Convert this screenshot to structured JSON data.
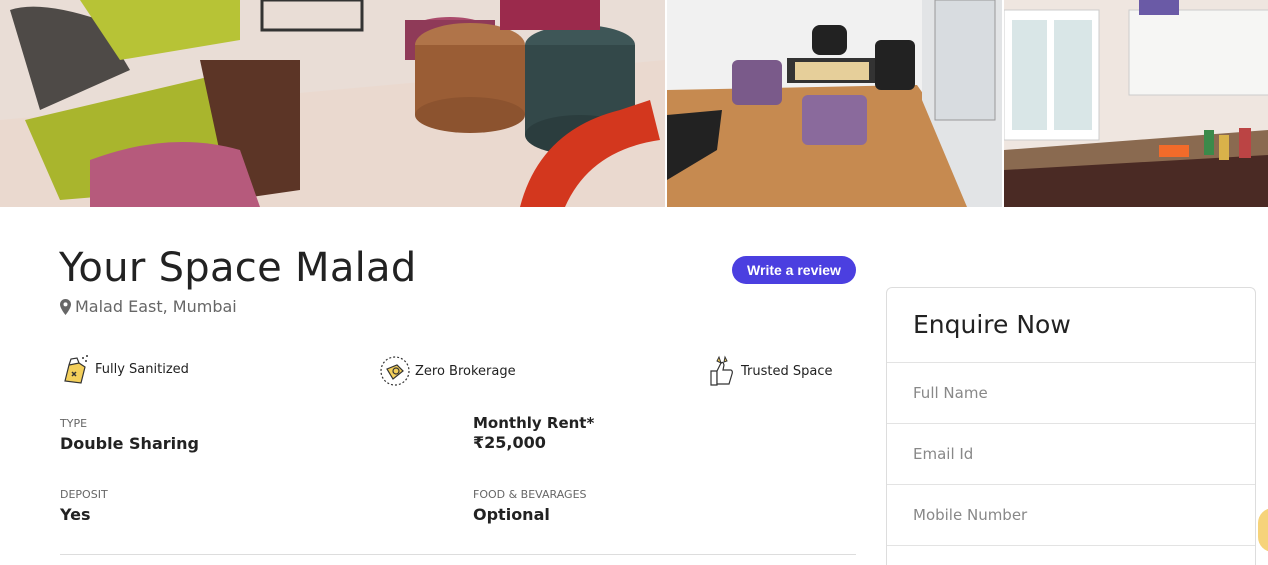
{
  "gallery": {
    "images": [
      {
        "icon": "lounge-photo"
      },
      {
        "icon": "game-room-photo"
      },
      {
        "icon": "kitchen-photo"
      }
    ]
  },
  "listing": {
    "title": "Your Space Malad",
    "location": "Malad East, Mumbai",
    "review_button": "Write a review"
  },
  "features": [
    {
      "label": "Fully Sanitized",
      "icon": "sanitizer-icon"
    },
    {
      "label": "Zero Brokerage",
      "icon": "zero-brokerage-icon"
    },
    {
      "label": "Trusted Space",
      "icon": "thumbs-up-icon"
    }
  ],
  "details": {
    "type_label": "TYPE",
    "type_value": "Double Sharing",
    "rent_label": "Monthly Rent*",
    "rent_value": "₹25,000",
    "deposit_label": "DEPOSIT",
    "deposit_value": "Yes",
    "food_label": "FOOD & BEVARAGES",
    "food_value": "Optional"
  },
  "enquire": {
    "title": "Enquire Now",
    "fields": [
      {
        "placeholder": "Full Name"
      },
      {
        "placeholder": "Email Id"
      },
      {
        "placeholder": "Mobile Number"
      }
    ]
  },
  "colors": {
    "accent": "#4b3fe0",
    "chat": "#f6d37a"
  }
}
